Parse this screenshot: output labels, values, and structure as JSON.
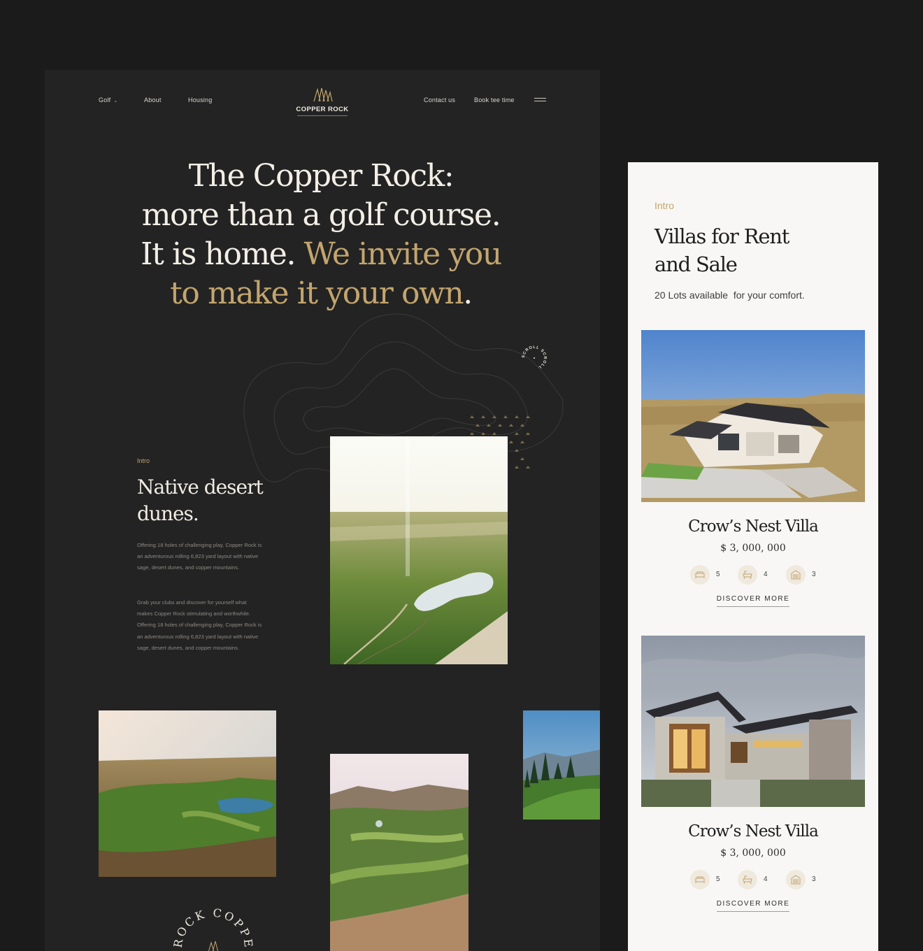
{
  "nav": {
    "golf": "Golf",
    "about": "About",
    "housing": "Housing",
    "contact": "Contact us",
    "book": "Book tee time"
  },
  "logo": {
    "text": "COPPER ROCK"
  },
  "hero": {
    "line1": "The Copper Rock:",
    "line2": "more than a golf course.",
    "line3_white": "It is home. ",
    "line3_gold": "We invite you",
    "line4_gold": "to make it your own",
    "line4_end": "."
  },
  "scroll_badge": {
    "text": "SCROLL SCROLL "
  },
  "intro": {
    "label": "Intro",
    "title": "Native desert dunes.",
    "p1": "Offering 18 holes of challenging play, Copper Rock is an adventurous rolling 6,823 yard layout with native sage, desert dunes, and copper mountains.",
    "p2": "Grab your clubs and discover for yourself what makes Copper Rock stimulating and worthwhile. Offering 18 holes of challenging play, Copper Rock is an adventurous rolling 6,823 yard layout with native sage, desert dunes, and copper mountains."
  },
  "footer_badge": {
    "text": "ROCK COPPER"
  },
  "mobile": {
    "intro": "Intro",
    "title": "Villas for Rent and Sale",
    "subtitle": "20 Lots available  for your comfort.",
    "cards": [
      {
        "title": "Crow’s Nest Villa",
        "price": "$ 3, 000, 000",
        "beds": "5",
        "baths": "4",
        "garage": "3",
        "cta": "DISCOVER MORE"
      },
      {
        "title": "Crow’s Nest Villa",
        "price": "$ 3, 000, 000",
        "beds": "5",
        "baths": "4",
        "garage": "3",
        "cta": "DISCOVER MORE"
      }
    ]
  },
  "colors": {
    "accent_gold": "#c3a56e",
    "dark_bg": "#232323",
    "page_bg": "#1b1b1b",
    "light_bg": "#f8f7f5"
  },
  "icons": [
    "chevron-down-icon",
    "menu-icon",
    "logo-icon",
    "bed-icon",
    "bath-icon",
    "garage-icon"
  ]
}
